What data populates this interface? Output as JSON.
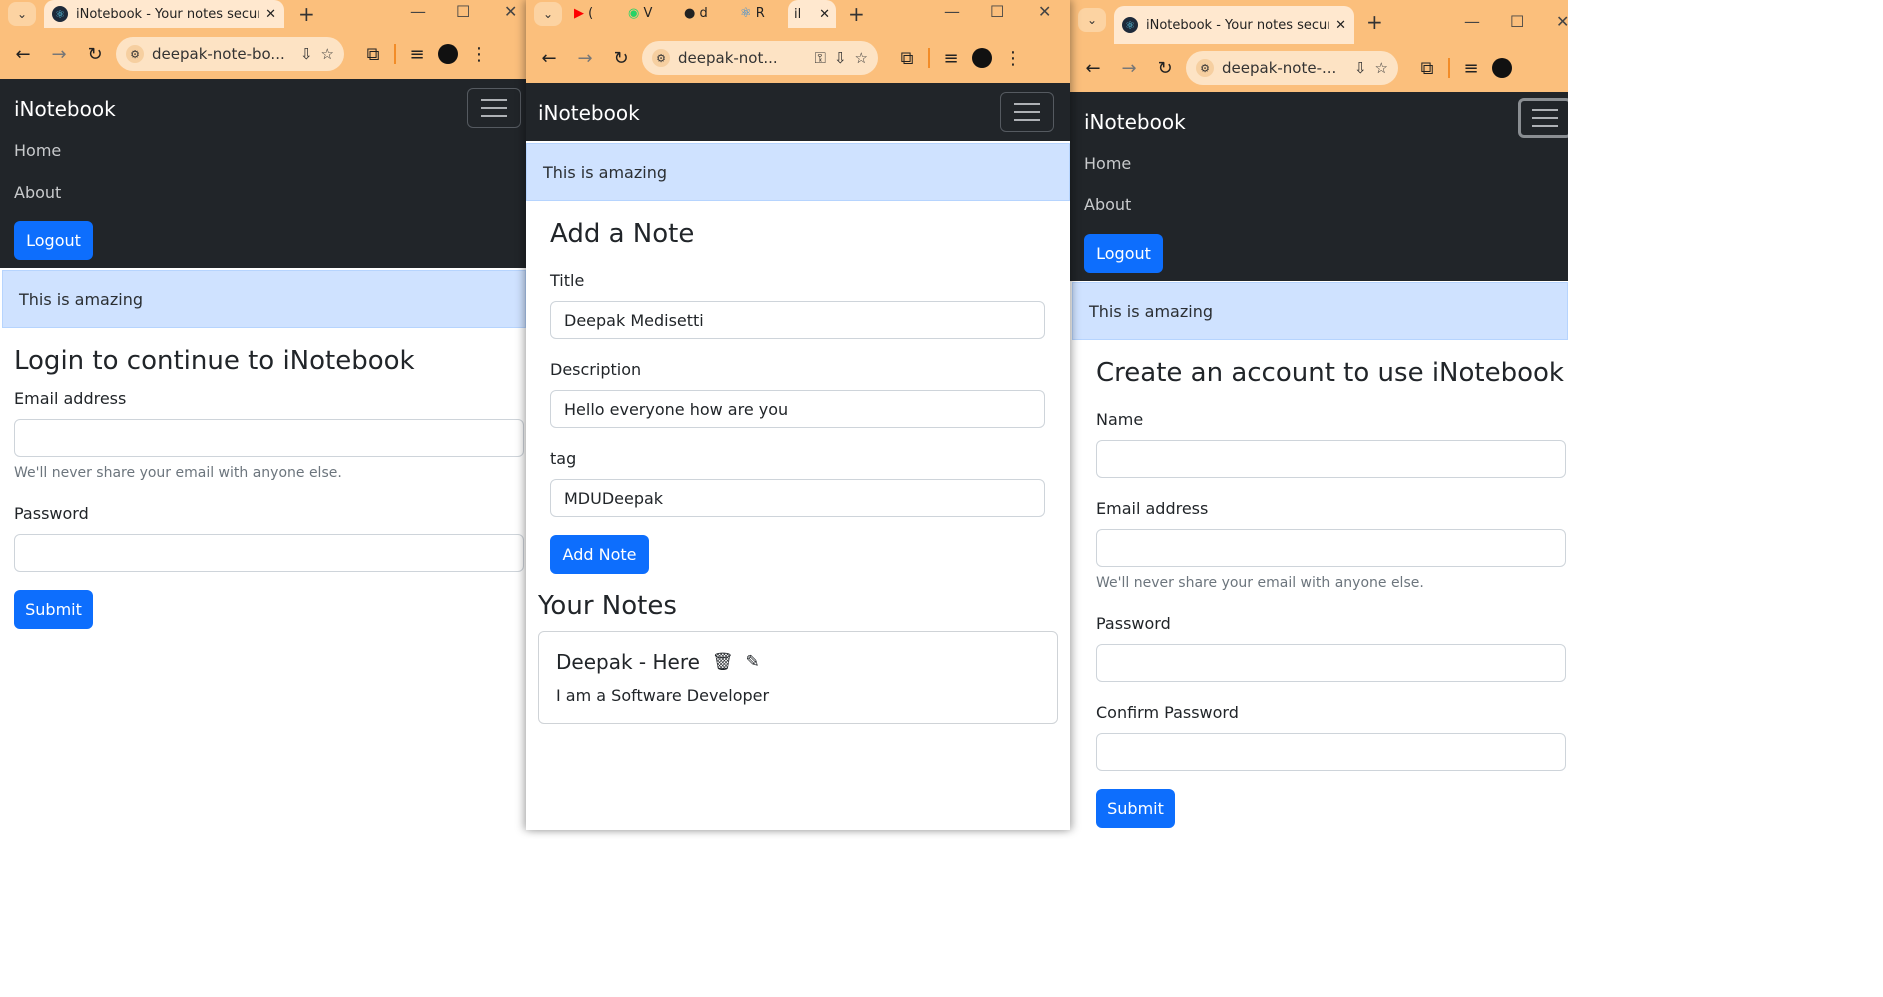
{
  "left_window": {
    "tab_title": "iNotebook - Your notes secured",
    "url": "deepak-note-bo...",
    "brand": "iNotebook",
    "nav": {
      "home": "Home",
      "about": "About",
      "logout": "Logout"
    },
    "alert": "This is amazing",
    "heading": "Login to continue to iNotebook",
    "email_label": "Email address",
    "email_value": "",
    "email_help": "We'll never share your email with anyone else.",
    "password_label": "Password",
    "password_value": "",
    "submit": "Submit"
  },
  "middle_window": {
    "tabs": [
      {
        "icon": "youtube-icon",
        "label": "("
      },
      {
        "icon": "whatsapp-icon",
        "label": "V"
      },
      {
        "icon": "github-icon",
        "label": "d"
      },
      {
        "icon": "react-icon",
        "label": "R"
      },
      {
        "icon": "none",
        "label": "il"
      }
    ],
    "url": "deepak-not...",
    "brand": "iNotebook",
    "alert": "This is amazing",
    "add_heading": "Add a Note",
    "title_label": "Title",
    "title_value": "Deepak Medisetti",
    "description_label": "Description",
    "description_value": "Hello everyone how are you",
    "tag_label": "tag",
    "tag_value": "MDUDeepak",
    "add_button": "Add Note",
    "notes_heading": "Your Notes",
    "note": {
      "title": "Deepak - Here",
      "description": "I am a Software Developer"
    }
  },
  "right_window": {
    "tab_title": "iNotebook - Your notes secured",
    "url": "deepak-note-...",
    "brand": "iNotebook",
    "nav": {
      "home": "Home",
      "about": "About",
      "logout": "Logout"
    },
    "alert": "This is amazing",
    "heading": "Create an account to use iNotebook",
    "name_label": "Name",
    "name_value": "",
    "email_label": "Email address",
    "email_value": "",
    "email_help": "We'll never share your email with anyone else.",
    "password_label": "Password",
    "password_value": "",
    "confirm_label": "Confirm Password",
    "confirm_value": "",
    "submit": "Submit"
  },
  "colors": {
    "chrome_frame": "#fbbf7c",
    "navbar": "#212529",
    "primary": "#0d6efd",
    "alert_bg": "#cfe2ff"
  }
}
